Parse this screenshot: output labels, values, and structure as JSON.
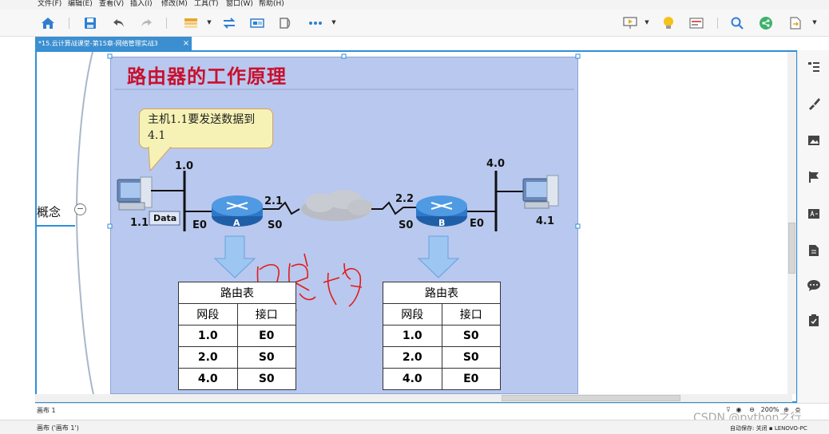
{
  "menu": [
    "文件(F)",
    "编辑(E)",
    "查看(V)",
    "插入(I)",
    "修改(M)",
    "工具(T)",
    "窗口(W)",
    "帮助(H)"
  ],
  "toolbar": {
    "left_icons": [
      "home-icon",
      "save-icon",
      "undo-icon",
      "redo-icon",
      "theme-icon",
      "relationship-icon",
      "summary-icon",
      "boundary-icon",
      "more-icon"
    ],
    "right_icons": [
      "presentation-icon",
      "lightbulb-icon",
      "format-icon",
      "search-icon",
      "share-icon",
      "export-icon"
    ]
  },
  "tab": {
    "title": "*15.云计算战课堂-第15章-网络管理实战3",
    "close": "×"
  },
  "mindmap": {
    "node_label": "概念",
    "collapse_symbol": "−"
  },
  "slide": {
    "title": "路由器的工作原理",
    "callout": "主机1.1要发送数据到4.1",
    "annotation": "自学总结",
    "labels": {
      "host1_ip": "1.1",
      "net_left": "1.0",
      "net_right": "4.0",
      "host2_ip": "4.1",
      "a_s0_ip": "2.1",
      "b_s0_ip": "2.2",
      "a_e0": "E0",
      "a_s0": "S0",
      "b_s0": "S0",
      "b_e0": "E0",
      "router_a": "A",
      "router_b": "B",
      "packet": "Data"
    },
    "table_a": {
      "title": "路由表",
      "headers": [
        "网段",
        "接口"
      ],
      "rows": [
        [
          "1.0",
          "E0"
        ],
        [
          "2.0",
          "S0"
        ],
        [
          "4.0",
          "S0"
        ]
      ]
    },
    "table_b": {
      "title": "路由表",
      "headers": [
        "网段",
        "接口"
      ],
      "rows": [
        [
          "1.0",
          "S0"
        ],
        [
          "2.0",
          "S0"
        ],
        [
          "4.0",
          "E0"
        ]
      ]
    }
  },
  "sidepanel_icons": [
    "outline-icon",
    "style-icon",
    "image-icon",
    "flag-icon",
    "text-style-icon",
    "notes-icon",
    "comment-icon",
    "task-icon"
  ],
  "sheet": {
    "tab_label": "画布 1",
    "zoom": "200%"
  },
  "status": {
    "left": "画布 ('画布 1')",
    "autosave": "自动保存: 关闭",
    "machine": "LENOVO-PC"
  },
  "watermark": "CSDN @python之行"
}
